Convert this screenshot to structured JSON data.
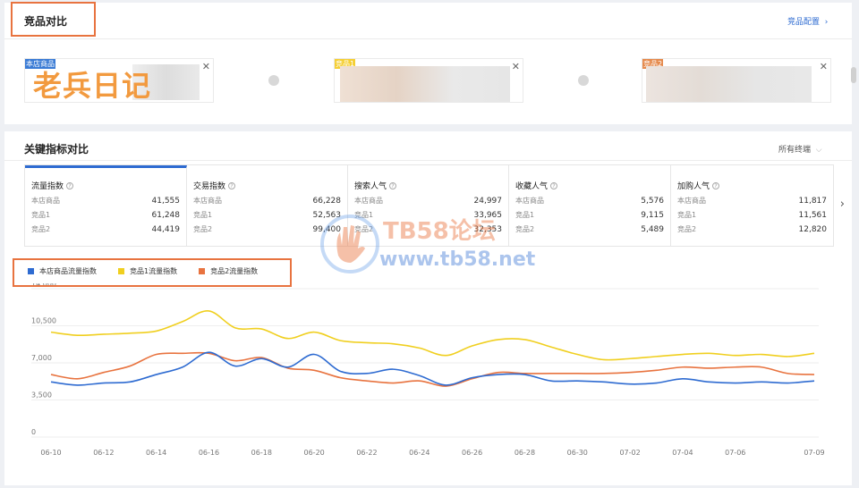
{
  "compare": {
    "title": "竞品对比",
    "config_link": "竞品配置",
    "slots": [
      {
        "tag": "本店商品"
      },
      {
        "tag": "竞品1"
      },
      {
        "tag": "竞品2"
      }
    ],
    "watermark": "老兵日记"
  },
  "metrics": {
    "title": "关键指标对比",
    "filter": "所有终端",
    "tabs": [
      {
        "title": "流量指数",
        "rows": [
          {
            "label": "本店商品",
            "value": "41,555"
          },
          {
            "label": "竞品1",
            "value": "61,248"
          },
          {
            "label": "竞品2",
            "value": "44,419"
          }
        ]
      },
      {
        "title": "交易指数",
        "rows": [
          {
            "label": "本店商品",
            "value": "66,228"
          },
          {
            "label": "竞品1",
            "value": "52,563"
          },
          {
            "label": "竞品2",
            "value": "99,400"
          }
        ]
      },
      {
        "title": "搜索人气",
        "rows": [
          {
            "label": "本店商品",
            "value": "24,997"
          },
          {
            "label": "竞品1",
            "value": "33,965"
          },
          {
            "label": "竞品2",
            "value": "32,353"
          }
        ]
      },
      {
        "title": "收藏人气",
        "rows": [
          {
            "label": "本店商品",
            "value": "5,576"
          },
          {
            "label": "竞品1",
            "value": "9,115"
          },
          {
            "label": "竞品2",
            "value": "5,489"
          }
        ]
      },
      {
        "title": "加购人气",
        "rows": [
          {
            "label": "本店商品",
            "value": "11,817"
          },
          {
            "label": "竞品1",
            "value": "11,561"
          },
          {
            "label": "竞品2",
            "value": "12,820"
          }
        ]
      }
    ]
  },
  "watermark_overlay": {
    "brand": "TB58论坛",
    "url": "www.tb58.net"
  },
  "colors": {
    "blue": "#2e6bd1",
    "yellow": "#f0cf1f",
    "orange": "#e8733f",
    "highlight": "#e8733f"
  },
  "chart_data": {
    "type": "line",
    "x": [
      "06-10",
      "06-11",
      "06-12",
      "06-13",
      "06-14",
      "06-15",
      "06-16",
      "06-17",
      "06-18",
      "06-19",
      "06-20",
      "06-21",
      "06-22",
      "06-23",
      "06-24",
      "06-25",
      "06-26",
      "06-27",
      "06-28",
      "06-29",
      "06-30",
      "07-01",
      "07-02",
      "07-03",
      "07-04",
      "07-05",
      "07-06",
      "07-07",
      "07-08",
      "07-09"
    ],
    "x_tick_labels": [
      "06-10",
      "06-12",
      "06-14",
      "06-16",
      "06-18",
      "06-20",
      "06-22",
      "06-24",
      "06-26",
      "06-28",
      "06-30",
      "07-02",
      "07-04",
      "07-06",
      "07-09"
    ],
    "y_ticks": [
      "0",
      "3,500",
      "7,000",
      "10,500",
      "14,000"
    ],
    "ylim": [
      0,
      14000
    ],
    "series": [
      {
        "name": "本店商品流量指数",
        "color": "#2e6bd1",
        "values": [
          5200,
          4900,
          5100,
          5200,
          5900,
          6600,
          8000,
          6700,
          7400,
          6600,
          7800,
          6200,
          6000,
          6400,
          5800,
          4900,
          5600,
          5900,
          5900,
          5300,
          5300,
          5200,
          5000,
          5100,
          5500,
          5200,
          5100,
          5200,
          5100,
          5300
        ]
      },
      {
        "name": "竞品1流量指数",
        "color": "#f0cf1f",
        "values": [
          9900,
          9600,
          9700,
          9800,
          10000,
          10900,
          11900,
          10300,
          10200,
          9300,
          9900,
          9100,
          8900,
          8800,
          8400,
          7700,
          8600,
          9200,
          9200,
          8500,
          7800,
          7300,
          7400,
          7600,
          7800,
          7900,
          7700,
          7800,
          7600,
          7900
        ]
      },
      {
        "name": "竞品2流量指数",
        "color": "#e8733f",
        "values": [
          5900,
          5500,
          6100,
          6700,
          7800,
          7900,
          7900,
          7200,
          7500,
          6500,
          6300,
          5600,
          5300,
          5100,
          5300,
          4800,
          5500,
          6100,
          6000,
          6000,
          6000,
          6000,
          6100,
          6300,
          6600,
          6500,
          6600,
          6600,
          6000,
          5900
        ]
      }
    ]
  }
}
